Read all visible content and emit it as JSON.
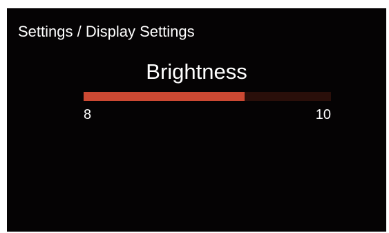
{
  "header": {
    "breadcrumb": "Settings / Display Settings"
  },
  "setting": {
    "title": "Brightness",
    "min_label": "8",
    "max_label": "10",
    "level_fraction": 0.65
  },
  "colors": {
    "background": "#050304",
    "slider_fill": "#cc4933",
    "slider_track": "#2a0f0a",
    "text": "#ffffff"
  }
}
